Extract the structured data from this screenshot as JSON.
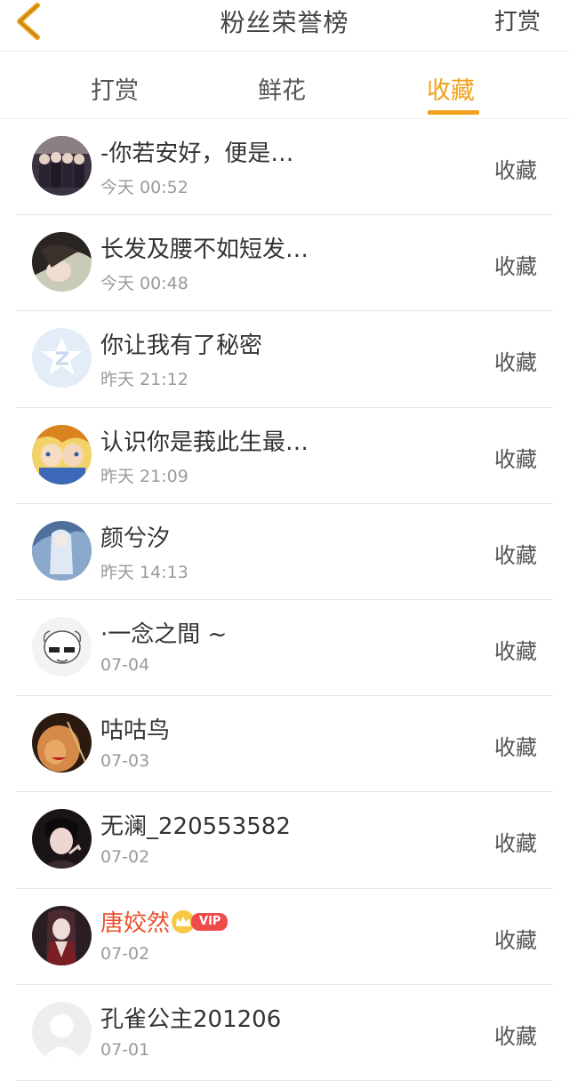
{
  "header": {
    "title": "粉丝荣誉榜",
    "action_label": "打赏",
    "back_icon": "chevron-left-icon",
    "accent_color": "#f0a21a"
  },
  "tabs": [
    {
      "label": "打赏",
      "active": false
    },
    {
      "label": "鲜花",
      "active": false
    },
    {
      "label": "收藏",
      "active": true
    }
  ],
  "fans": [
    {
      "name": "-你若安好，便是…",
      "time": "今天 00:52",
      "action": "收藏",
      "avatar": "avatar-girls-group"
    },
    {
      "name": "长发及腰不如短发…",
      "time": "今天 00:48",
      "action": "收藏",
      "avatar": "avatar-girl-hair"
    },
    {
      "name": "你让我有了秘密",
      "time": "昨天 21:12",
      "action": "收藏",
      "avatar": "avatar-default-star"
    },
    {
      "name": "认识你是莪此生最…",
      "time": "昨天 21:09",
      "action": "收藏",
      "avatar": "avatar-anime"
    },
    {
      "name": "颜兮汐",
      "time": "昨天 14:13",
      "action": "收藏",
      "avatar": "avatar-blue-art"
    },
    {
      "name": "·一念之間 ~",
      "time": "07-04",
      "action": "收藏",
      "avatar": "avatar-sketch-face"
    },
    {
      "name": "咕咕鸟",
      "time": "07-03",
      "action": "收藏",
      "avatar": "avatar-red-face"
    },
    {
      "name": "无澜_220553582",
      "time": "07-02",
      "action": "收藏",
      "avatar": "avatar-dark-portrait"
    },
    {
      "name": "唐姣然",
      "time": "07-02",
      "action": "收藏",
      "avatar": "avatar-dark-red",
      "vip": "VIP"
    },
    {
      "name": "孔雀公主201206",
      "time": "07-01",
      "action": "收藏",
      "avatar": "avatar-default-person"
    }
  ]
}
